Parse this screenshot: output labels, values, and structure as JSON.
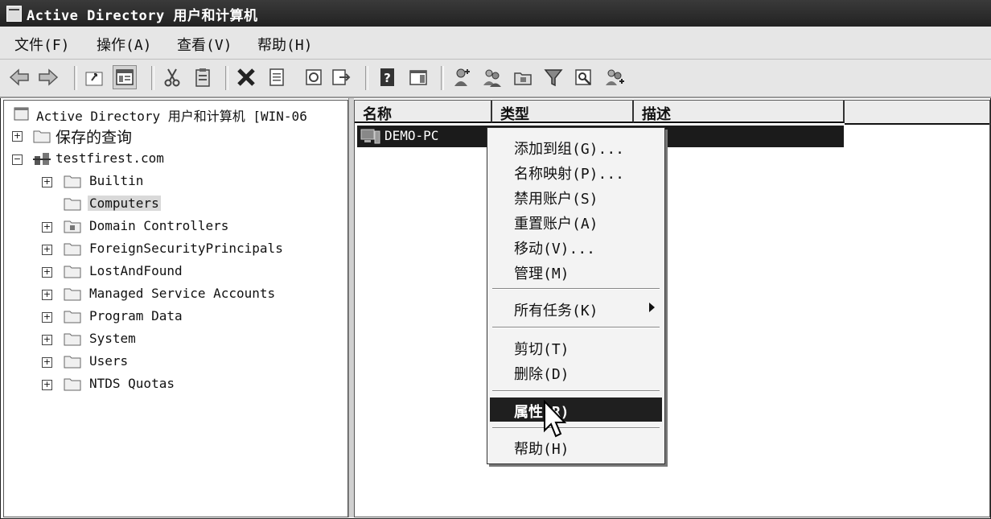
{
  "window": {
    "title": "Active Directory 用户和计算机"
  },
  "menu": [
    "文件(F)",
    "操作(A)",
    "查看(V)",
    "帮助(H)"
  ],
  "toolbar_icons": [
    "back-icon",
    "forward-icon",
    "up-icon",
    "show-hide-tree-icon",
    "cut-icon",
    "paste-icon",
    "delete-icon",
    "properties-icon",
    "refresh-icon",
    "export-icon",
    "help-icon",
    "action-pane-icon",
    "new-user-icon",
    "new-group-icon",
    "new-ou-icon",
    "filter-icon",
    "find-icon",
    "add-to-group-icon"
  ],
  "tree": {
    "root": "Active Directory 用户和计算机 [WIN-06",
    "saved_queries": "保存的查询",
    "domain": "testfirest.com",
    "children": [
      "Builtin",
      "Computers",
      "Domain Controllers",
      "ForeignSecurityPrincipals",
      "LostAndFound",
      "Managed Service Accounts",
      "Program Data",
      "System",
      "Users",
      "NTDS Quotas"
    ],
    "selected": "Computers"
  },
  "list": {
    "columns": [
      "名称",
      "类型",
      "描述"
    ],
    "rows": [
      {
        "name": "DEMO-PC"
      }
    ]
  },
  "context_menu": {
    "items": [
      "添加到组(G)...",
      "名称映射(P)...",
      "禁用账户(S)",
      "重置账户(A)",
      "移动(V)...",
      "管理(M)",
      "所有任务(K)",
      "剪切(T)",
      "删除(D)",
      "属性(R)",
      "帮助(H)"
    ],
    "highlighted": "属性(R)"
  }
}
